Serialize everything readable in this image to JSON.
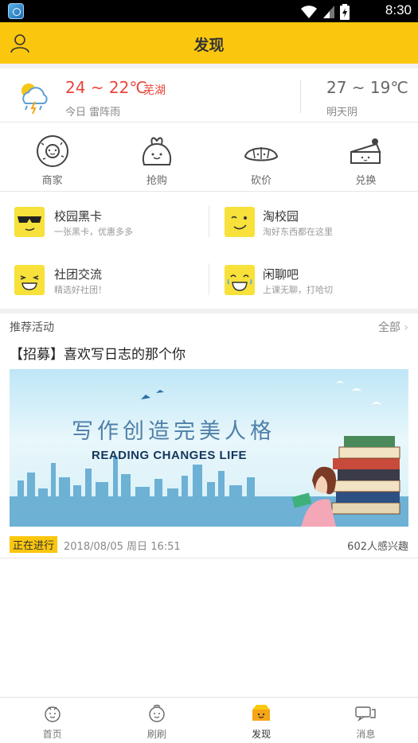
{
  "status_bar": {
    "time": "8:30"
  },
  "header": {
    "title": "发现"
  },
  "weather": {
    "today_temp": "24 ~ 22℃",
    "city": "芜湖",
    "today_desc": "今日 雷阵雨",
    "tomorrow_temp": "27 ~ 19℃",
    "tomorrow_desc": "明天阴",
    "accent_color": "#e8453c"
  },
  "quick_actions": [
    {
      "label": "商家",
      "icon": "donut-icon"
    },
    {
      "label": "抢购",
      "icon": "bag-icon"
    },
    {
      "label": "砍价",
      "icon": "croissant-icon"
    },
    {
      "label": "兑换",
      "icon": "cake-icon"
    }
  ],
  "features": [
    {
      "title": "校园黑卡",
      "subtitle": "一张黑卡，优惠多多",
      "icon": "sunglasses-face-icon"
    },
    {
      "title": "淘校园",
      "subtitle": "淘好东西都在这里",
      "icon": "wink-face-icon"
    },
    {
      "title": "社团交流",
      "subtitle": "精选好社团！",
      "icon": "grin-face-icon"
    },
    {
      "title": "闲聊吧",
      "subtitle": "上课无聊，打哈切",
      "icon": "laugh-cry-face-icon"
    }
  ],
  "section": {
    "title": "推荐活动",
    "more": "全部"
  },
  "activity": {
    "title": "【招募】喜欢写日志的那个你",
    "banner_cn": "写作创造完美人格",
    "banner_en": "READING CHANGES LIFE",
    "status": "正在进行",
    "date": "2018/08/05 周日 16:51",
    "interest": "602人感兴趣"
  },
  "tabs": [
    {
      "label": "首页",
      "icon": "home-mascot-icon"
    },
    {
      "label": "刷刷",
      "icon": "refresh-mascot-icon"
    },
    {
      "label": "发现",
      "icon": "discover-box-icon"
    },
    {
      "label": "消息",
      "icon": "message-icon"
    }
  ],
  "colors": {
    "brand": "#fbc70e",
    "emoji": "#f7e13a"
  }
}
